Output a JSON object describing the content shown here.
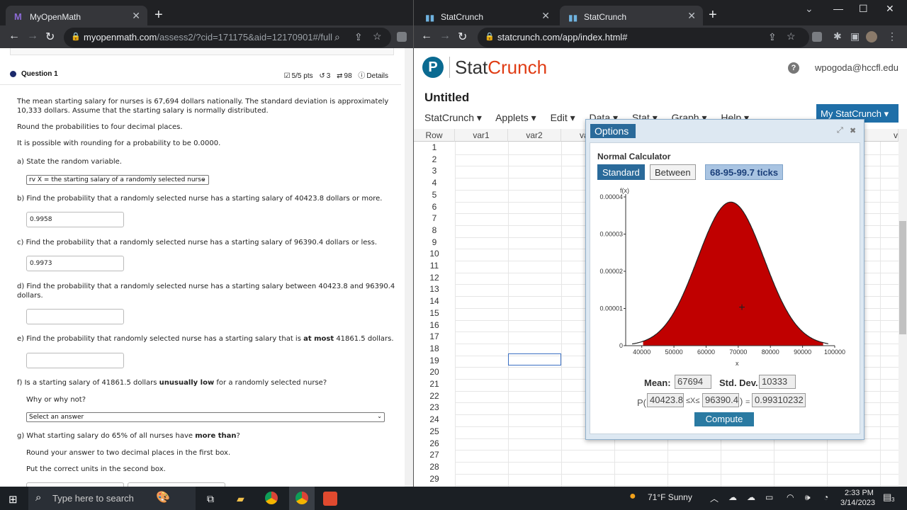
{
  "left_browser": {
    "tab_title": "MyOpenMath",
    "new_tab": "+",
    "url_host": "myopenmath.com",
    "url_path": "/assess2/?cid=171175&aid=12170901#/full"
  },
  "question": {
    "title": "Question 1",
    "score": "5/5 pts",
    "retries": "3",
    "versions": "98",
    "details": "Details",
    "intro1": "The mean starting salary for nurses is 67,694 dollars nationally. The standard deviation is approximately",
    "intro2": "10,333 dollars. Assume that the starting salary is normally distributed.",
    "round_text": "Round the probabilities to four decimal places.",
    "possible_text": "It is possible with rounding for a probability to be 0.0000.",
    "a_text": "a) State the random variable.",
    "a_select": "rv X = the starting salary of a randomly selected nurse",
    "b_text": "b) Find the probability that a randomly selected nurse has a starting salary of 40423.8 dollars or more.",
    "b_value": "0.9958",
    "c_text": "c) Find the probability that a randomly selected nurse has a starting salary of 96390.4 dollars or less.",
    "c_value": "0.9973",
    "d_text1": "d) Find the probability that a randomly selected nurse has a starting salary between 40423.8 and 96390.4",
    "d_text2": "dollars.",
    "d_value": "",
    "e_text_pre": "e) Find the probability that randomly selected nurse has a starting salary that is ",
    "e_text_bold": "at most",
    "e_text_post": " 41861.5 dollars.",
    "e_value": "",
    "f_text_pre": "f) Is a starting salary of 41861.5 dollars ",
    "f_text_bold": "unusually low",
    "f_text_post": " for a randomly selected nurse?",
    "why_text": "Why or why not?",
    "f_select": "Select an answer",
    "g_text_pre": "g) What starting salary do 65% of all nurses have ",
    "g_text_bold": "more than",
    "g_text_post": "?",
    "g_round": "Round your answer to two decimal places in the first box.",
    "g_units": "Put the correct units in the second box."
  },
  "right_browser": {
    "tab1_title": "StatCrunch",
    "tab2_title": "StatCrunch",
    "new_tab": "+",
    "url": "statcrunch.com/app/index.html#"
  },
  "statcrunch": {
    "logo_letter": "P",
    "brand_stat": "Stat",
    "brand_crunch": "Crunch",
    "help": "?",
    "user": "wpogoda@hccfl.edu",
    "doc_title": "Untitled",
    "menu": [
      "StatCrunch ▾",
      "Applets ▾",
      "Edit ▾",
      "Data ▾",
      "Stat ▾",
      "Graph ▾",
      "Help ▾"
    ],
    "my_statcrunch": "My StatCrunch ▾",
    "col_row": "Row",
    "columns": [
      "var1",
      "var2",
      "va"
    ],
    "right_col_partial": "v",
    "rows": [
      "1",
      "2",
      "3",
      "4",
      "5",
      "6",
      "7",
      "8",
      "9",
      "10",
      "11",
      "12",
      "13",
      "14",
      "15",
      "16",
      "17",
      "18",
      "19",
      "20",
      "21",
      "22",
      "23",
      "24",
      "25",
      "26",
      "27",
      "28",
      "29"
    ]
  },
  "dialog": {
    "title": "Options",
    "heading": "Normal Calculator",
    "tab_standard": "Standard",
    "tab_between": "Between",
    "tab_ticks": "68-95-99.7 ticks",
    "mean_label": "Mean:",
    "mean_value": "67694",
    "sd_label": "Std. Dev.:",
    "sd_value": "10333",
    "p_open": "P(",
    "lower": "40423.8",
    "between_sym": "≤X≤",
    "upper": "96390.4",
    "p_close": ")",
    "equals": "=",
    "result": "0.99310232",
    "compute": "Compute"
  },
  "chart_data": {
    "type": "area",
    "ylabel": "f(x)",
    "xlabel": "x",
    "x_ticks": [
      "40000",
      "50000",
      "60000",
      "70000",
      "80000",
      "90000",
      "100000"
    ],
    "y_ticks": [
      "0",
      "0.00001",
      "0.00002",
      "0.00003",
      "0.00004"
    ],
    "xlim": [
      35000,
      100000
    ],
    "ylim": [
      0,
      4e-05
    ],
    "mean": 67694,
    "sd": 10333,
    "shaded_from": 40423.8,
    "shaded_to": 96390.4,
    "fill_color": "#c00000"
  },
  "taskbar": {
    "search_placeholder": "Type here to search",
    "weather": "71°F  Sunny",
    "time": "2:33 PM",
    "date": "3/14/2023",
    "notif_count": "3"
  }
}
